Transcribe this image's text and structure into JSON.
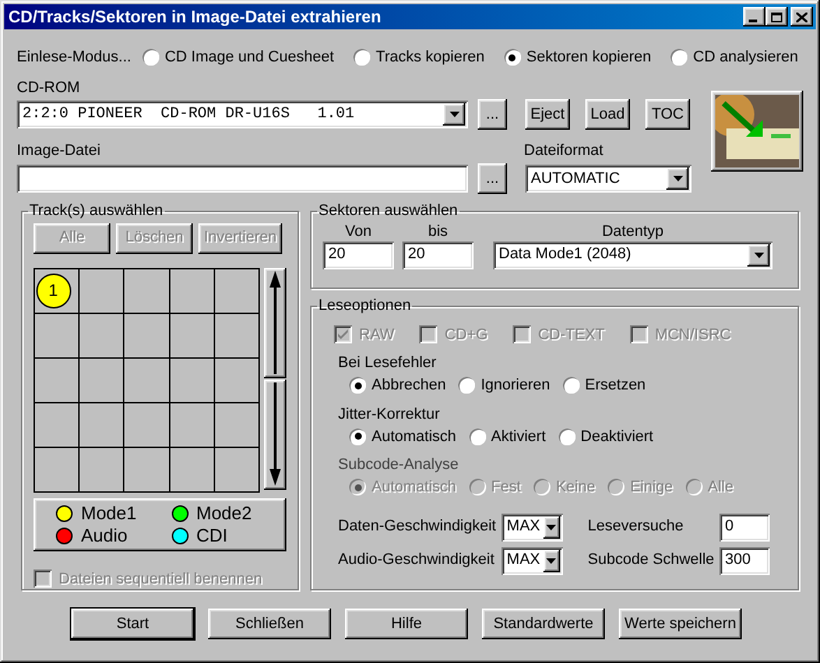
{
  "window": {
    "title": "CD/Tracks/Sektoren in Image-Datei extrahieren"
  },
  "mode": {
    "label": "Einlese-Modus...",
    "options": [
      {
        "label": "CD Image und Cuesheet",
        "selected": false
      },
      {
        "label": "Tracks kopieren",
        "selected": false
      },
      {
        "label": "Sektoren kopieren",
        "selected": true
      },
      {
        "label": "CD analysieren",
        "selected": false
      }
    ]
  },
  "cdrom": {
    "label": "CD-ROM",
    "value": "2:2:0 PIONEER  CD-ROM DR-U16S   1.01",
    "browse": "..."
  },
  "drive_buttons": [
    "Eject",
    "Load",
    "TOC"
  ],
  "image_file": {
    "label": "Image-Datei",
    "browse": "..."
  },
  "file_format": {
    "label": "Dateiformat",
    "value": "AUTOMATIC"
  },
  "tracks": {
    "title": "Track(s) auswählen",
    "buttons": [
      {
        "label": "Alle",
        "disabled": true
      },
      {
        "label": "Löschen",
        "disabled": true
      },
      {
        "label": "Invertieren",
        "disabled": true
      }
    ],
    "cells": [
      {
        "label": "1",
        "color": "#ffff00"
      }
    ],
    "legend": [
      {
        "label": "Mode1",
        "color": "#ffff00"
      },
      {
        "label": "Mode2",
        "color": "#00ff00"
      },
      {
        "label": "Audio",
        "color": "#ff0000"
      },
      {
        "label": "CDI",
        "color": "#00ffff"
      }
    ],
    "sequential": {
      "label": "Dateien sequentiell benennen",
      "checked": false,
      "disabled": true
    }
  },
  "sectors": {
    "title": "Sektoren auswählen",
    "from": {
      "label": "Von",
      "value": "20"
    },
    "to": {
      "label": "bis",
      "value": "20"
    },
    "datatype": {
      "label": "Datentyp",
      "value": "Data Mode1 (2048)"
    }
  },
  "read_options": {
    "title": "Leseoptionen",
    "checkboxes": [
      {
        "label": "RAW",
        "checked": true,
        "disabled": true
      },
      {
        "label": "CD+G",
        "checked": false,
        "disabled": true
      },
      {
        "label": "CD-TEXT",
        "checked": false,
        "disabled": true
      },
      {
        "label": "MCN/ISRC",
        "checked": false,
        "disabled": true
      }
    ],
    "groups": [
      {
        "label": "Bei Lesefehler",
        "disabled": false,
        "options": [
          {
            "label": "Abbrechen",
            "selected": true
          },
          {
            "label": "Ignorieren",
            "selected": false
          },
          {
            "label": "Ersetzen",
            "selected": false
          }
        ]
      },
      {
        "label": "Jitter-Korrektur",
        "disabled": false,
        "options": [
          {
            "label": "Automatisch",
            "selected": true
          },
          {
            "label": "Aktiviert",
            "selected": false
          },
          {
            "label": "Deaktiviert",
            "selected": false
          }
        ]
      },
      {
        "label": "Subcode-Analyse",
        "disabled": true,
        "options": [
          {
            "label": "Automatisch",
            "selected": true
          },
          {
            "label": "Fest",
            "selected": false
          },
          {
            "label": "Keine",
            "selected": false
          },
          {
            "label": "Einige",
            "selected": false
          },
          {
            "label": "Alle",
            "selected": false
          }
        ]
      }
    ],
    "fields": [
      {
        "label": "Daten-Geschwindigkeit",
        "kind": "combo",
        "value": "MAX"
      },
      {
        "label": "Leseversuche",
        "kind": "text",
        "value": "0"
      },
      {
        "label": "Audio-Geschwindigkeit",
        "kind": "combo",
        "value": "MAX"
      },
      {
        "label": "Subcode Schwelle",
        "kind": "text",
        "value": "300"
      }
    ]
  },
  "buttons": [
    {
      "label": "Start",
      "default": true
    },
    {
      "label": "Schließen",
      "default": false
    },
    {
      "label": "Hilfe",
      "default": false
    },
    {
      "label": "Standardwerte",
      "default": false
    },
    {
      "label": "Werte speichern",
      "default": false
    }
  ]
}
